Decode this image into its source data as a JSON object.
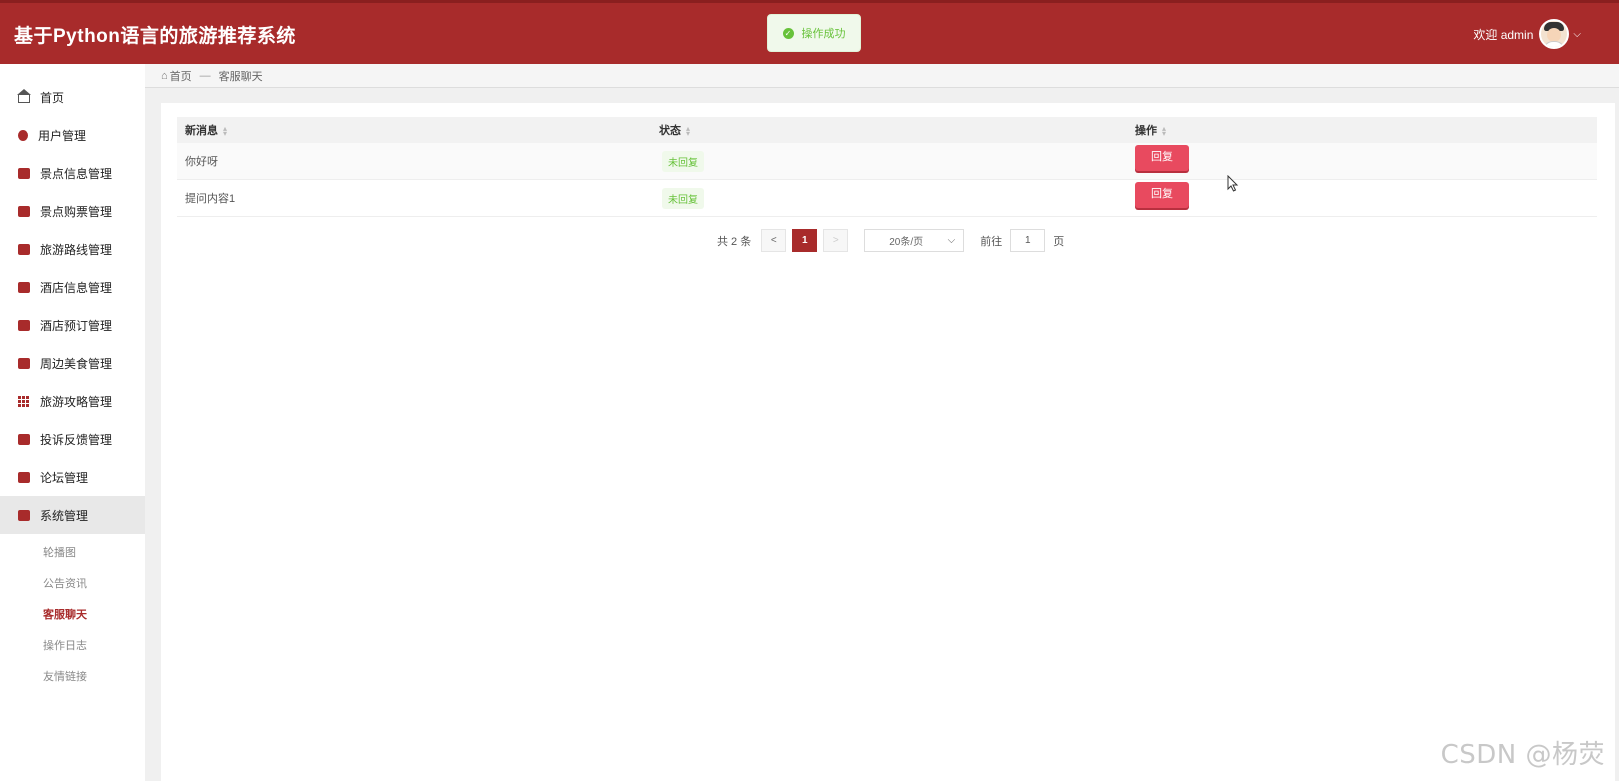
{
  "header": {
    "title": "基于Python语言的旅游推荐系统",
    "welcome": "欢迎 admin",
    "caret": "⌵"
  },
  "toast": {
    "message": "操作成功"
  },
  "sidebar": {
    "items": [
      {
        "label": "首页",
        "icon": "home-icon"
      },
      {
        "label": "用户管理",
        "icon": "user-icon"
      },
      {
        "label": "景点信息管理",
        "icon": "folder-icon"
      },
      {
        "label": "景点购票管理",
        "icon": "briefcase-icon"
      },
      {
        "label": "旅游路线管理",
        "icon": "gift-icon"
      },
      {
        "label": "酒店信息管理",
        "icon": "folder-icon"
      },
      {
        "label": "酒店预订管理",
        "icon": "list-icon"
      },
      {
        "label": "周边美食管理",
        "icon": "folder-icon"
      },
      {
        "label": "旅游攻略管理",
        "icon": "grid-icon"
      },
      {
        "label": "投诉反馈管理",
        "icon": "book-icon"
      },
      {
        "label": "论坛管理",
        "icon": "briefcase-icon"
      },
      {
        "label": "系统管理",
        "icon": "briefcase-icon"
      }
    ],
    "submenu": [
      {
        "label": "轮播图"
      },
      {
        "label": "公告资讯"
      },
      {
        "label": "客服聊天"
      },
      {
        "label": "操作日志"
      },
      {
        "label": "友情链接"
      }
    ]
  },
  "breadcrumb": {
    "home": "首页",
    "separator": "—",
    "current": "客服聊天"
  },
  "table": {
    "headers": [
      "新消息",
      "状态",
      "操作"
    ],
    "rows": [
      {
        "message": "你好呀",
        "status": "未回复",
        "action": "回复"
      },
      {
        "message": "提问内容1",
        "status": "未回复",
        "action": "回复"
      }
    ]
  },
  "pagination": {
    "total": "共 2 条",
    "prev": "<",
    "current": "1",
    "next": ">",
    "page_size": "20条/页",
    "goto_label": "前往",
    "goto_value": "1",
    "page_unit": "页"
  },
  "watermark": "CSDN @杨荧",
  "colors": {
    "brand": "#a82b2b",
    "reply_button": "#e84a5f",
    "success": "#67c23a"
  }
}
